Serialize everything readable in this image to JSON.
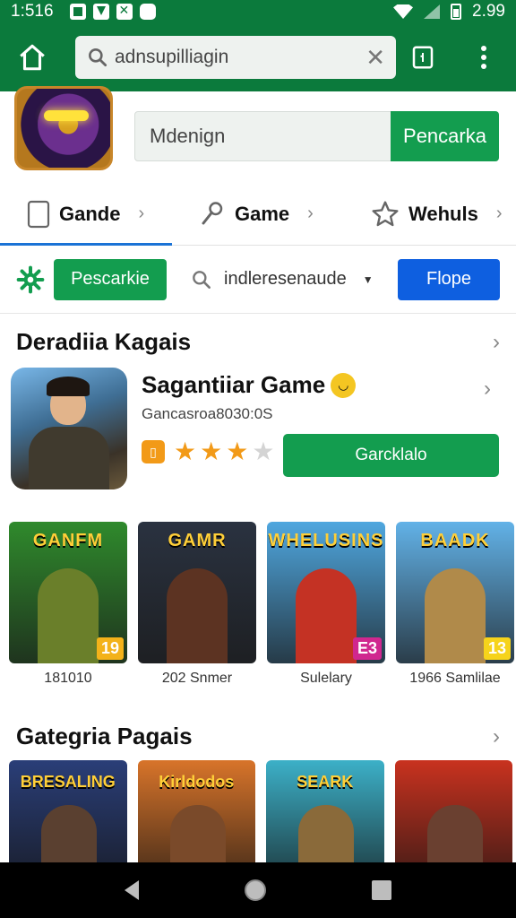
{
  "status_bar": {
    "time": "1:516",
    "battery": "2.99"
  },
  "toolbar": {
    "search_value": "adnsupilliagin",
    "clear_label": "✕"
  },
  "hero": {
    "input_value": "Mdenign",
    "button_label": "Pencarka"
  },
  "category_tabs": [
    {
      "label": "Gande",
      "icon": "tablet-icon"
    },
    {
      "label": "Game",
      "icon": "wrench-icon"
    },
    {
      "label": "Wehuls",
      "icon": "star-icon"
    }
  ],
  "filters": {
    "green_button": "Pescarkie",
    "select_value": "indleresenaude",
    "blue_button": "Flope"
  },
  "featured_section": {
    "title": "Deradiia Kagais",
    "app_title": "Sagantiiar Game",
    "app_subtitle": "Gancasroa8030:0S",
    "rating": 3,
    "rating_max": 4,
    "install_label": "Garcklalo"
  },
  "games": [
    {
      "logo": "GANFM",
      "label": "181010",
      "badge": "19",
      "bg": "#2f8a2c",
      "figure": "#6a7f2a",
      "badge_bg": "#f3b21a"
    },
    {
      "logo": "GAMR",
      "label": "202 Snmer",
      "badge": "",
      "bg": "#2a3240",
      "figure": "#5c3322",
      "badge_bg": ""
    },
    {
      "logo": "WHELUSINS",
      "label": "Sulelary",
      "badge": "E3",
      "bg": "#4fa7df",
      "figure": "#c43224",
      "badge_bg": "#d0278f"
    },
    {
      "logo": "BAADK",
      "label": "1966 Samlilae",
      "badge": "13",
      "bg": "#62b2e8",
      "figure": "#b08a4a",
      "badge_bg": "#f6d31b"
    }
  ],
  "category_section": {
    "title": "Gategria Pagais"
  },
  "categories": [
    {
      "logo": "BRESALING",
      "bg": "#2a3e78",
      "figure": "#5a4030"
    },
    {
      "logo": "Kirldodos",
      "bg": "#d8742a",
      "figure": "#7a4a2a"
    },
    {
      "logo": "SEARK",
      "bg": "#3cb0c8",
      "figure": "#8a6a3a"
    },
    {
      "logo": "",
      "bg": "#c9321f",
      "figure": "#6a4030"
    }
  ]
}
